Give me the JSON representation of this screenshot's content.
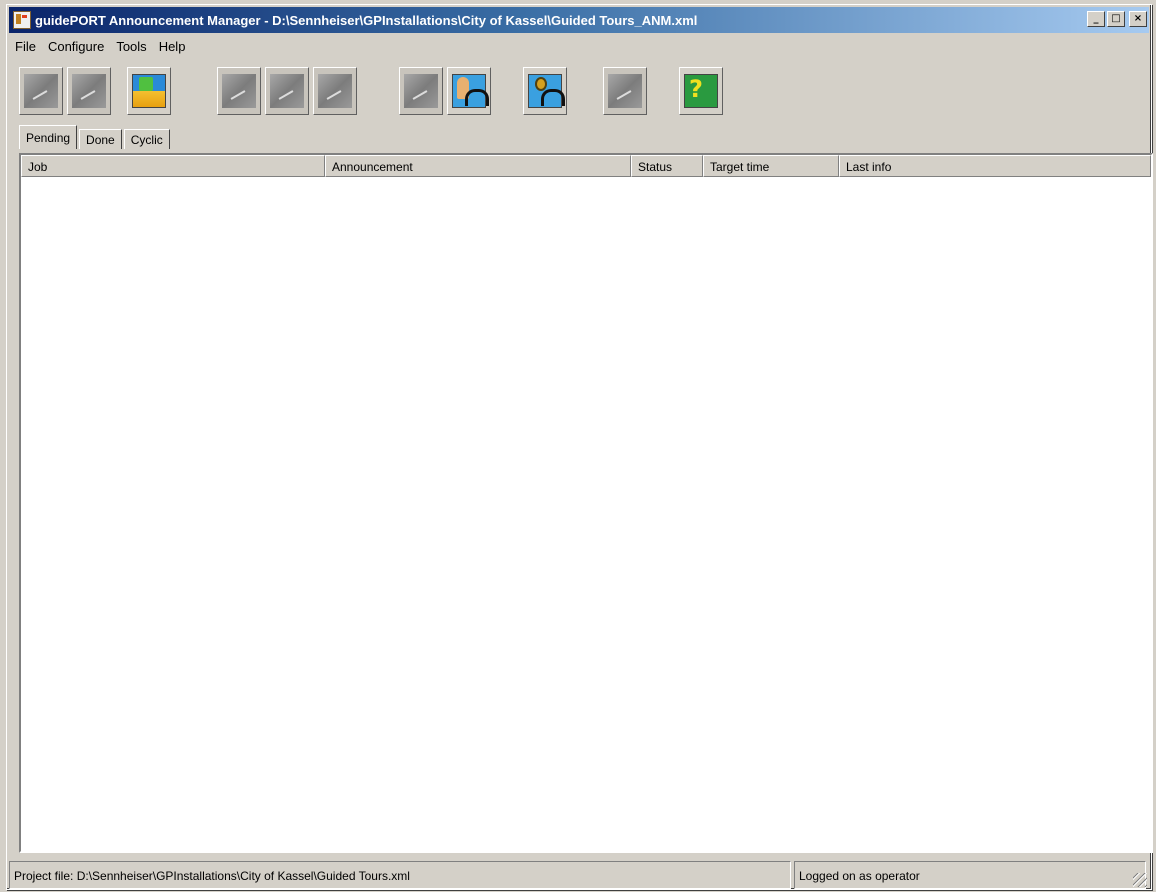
{
  "window": {
    "title": "guidePORT Announcement Manager - D:\\Sennheiser\\GPInstallations\\City of Kassel\\Guided Tours_ANM.xml",
    "buttons": {
      "minimize": "_",
      "maximize": "□",
      "close": "×"
    }
  },
  "menu": [
    "File",
    "Configure",
    "Tools",
    "Help"
  ],
  "toolbar": {
    "buttons": [
      {
        "icon": "disabled-tool-1-icon",
        "enabled": false
      },
      {
        "icon": "disabled-tool-2-icon",
        "enabled": false
      },
      {
        "icon": "open-project-icon",
        "enabled": true
      },
      {
        "icon": "disabled-tool-3-icon",
        "enabled": false
      },
      {
        "icon": "disabled-tool-4-icon",
        "enabled": false
      },
      {
        "icon": "disabled-tool-5-icon",
        "enabled": false
      },
      {
        "icon": "disabled-tool-6-icon",
        "enabled": false
      },
      {
        "icon": "speaker-headphones-icon",
        "enabled": true
      },
      {
        "icon": "watch-headphones-icon",
        "enabled": true
      },
      {
        "icon": "disabled-tool-7-icon",
        "enabled": false
      },
      {
        "icon": "help-icon",
        "enabled": true
      }
    ]
  },
  "tabs": [
    "Pending",
    "Done",
    "Cyclic"
  ],
  "active_tab": "Pending",
  "table": {
    "columns": [
      "Job",
      "Announcement",
      "Status",
      "Target time",
      "Last info"
    ],
    "rows": []
  },
  "status": {
    "project": "Project file: D:\\Sennheiser\\GPInstallations\\City of Kassel\\Guided Tours.xml",
    "login": "Logged on as operator"
  }
}
